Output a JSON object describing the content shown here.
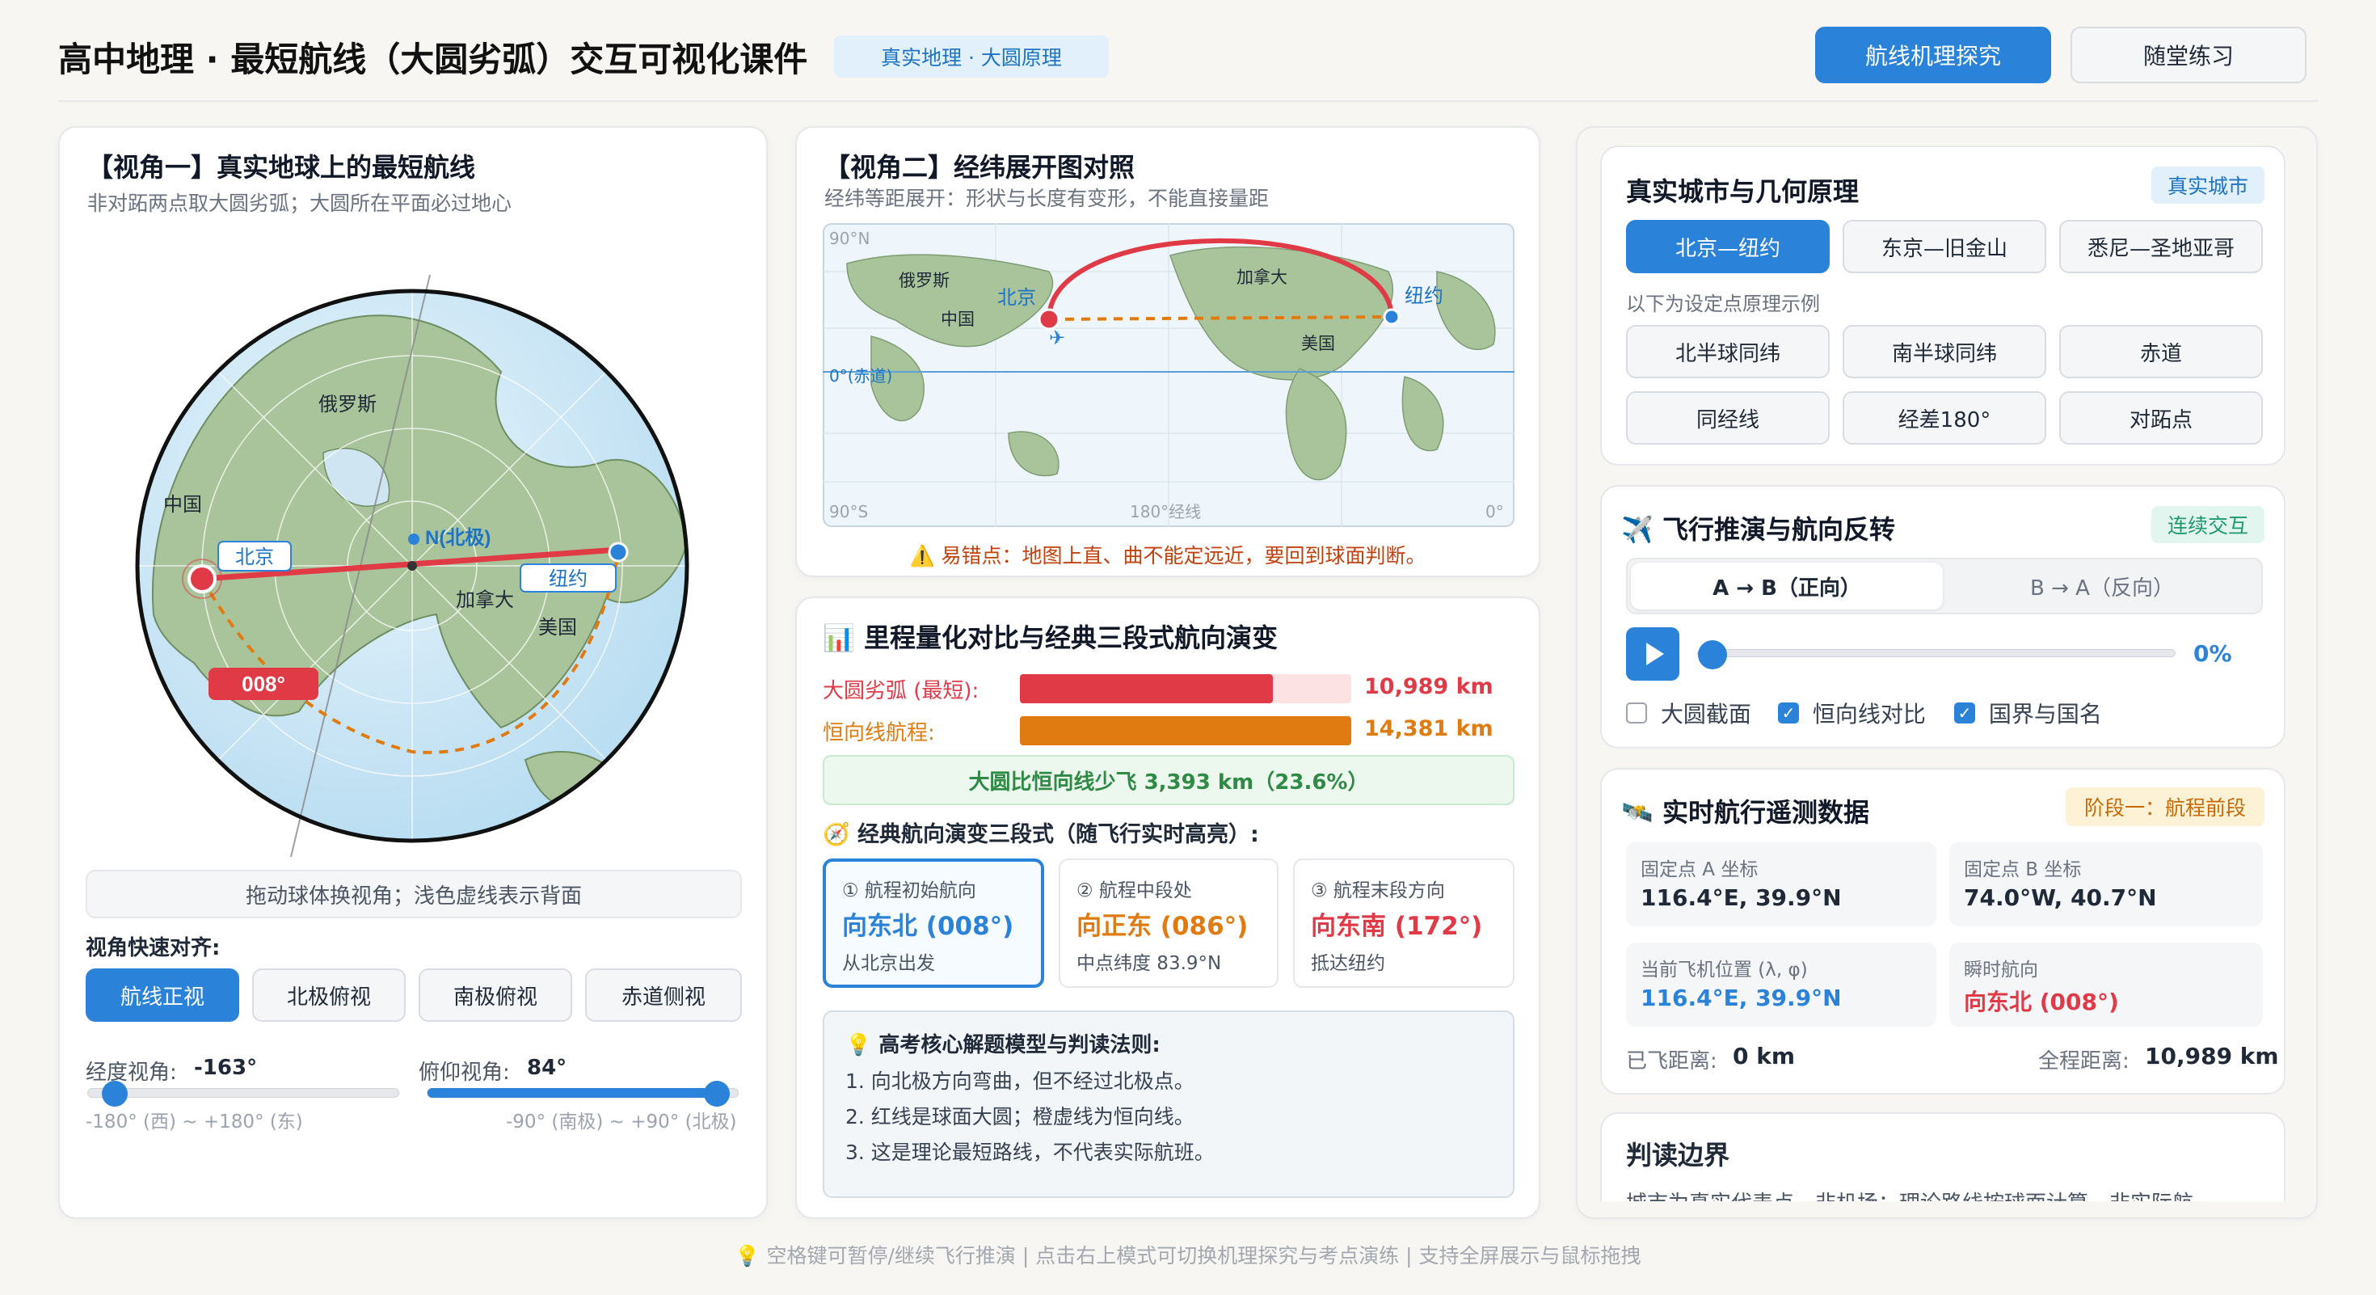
{
  "header": {
    "title": "高中地理 · 最短航线（大圆劣弧）交互可视化课件",
    "tag": "真实地理 · 大圆原理",
    "mode_explore": "航线机理探究",
    "mode_practice": "随堂练习"
  },
  "panel1": {
    "title": "【视角一】真实地球上的最短航线",
    "subtitle": "非对跖两点取大圆劣弧；大圆所在平面必过地心",
    "globe_labels": {
      "russia": "俄罗斯",
      "china": "中国",
      "north_pole": "N(北极)",
      "beijing": "北京",
      "newyork": "纽约",
      "canada": "加拿大",
      "usa": "美国",
      "heading_badge": "008°"
    },
    "drag_hint": "拖动球体换视角；浅色虚线表示背面",
    "quick_align_label": "视角快速对齐:",
    "views": [
      "航线正视",
      "北极俯视",
      "南极俯视",
      "赤道侧视"
    ],
    "lon_label": "经度视角:",
    "lon_value": "-163°",
    "lon_range": "-180° (西) ~ +180° (东)",
    "lon_fraction": 0.047,
    "tilt_label": "俯仰视角:",
    "tilt_value": "84°",
    "tilt_range": "-90° (南极) ~ +90° (北极)",
    "tilt_fraction": 0.967
  },
  "panel2": {
    "title": "【视角二】经纬展开图对照",
    "subtitle": "经纬等距展开：形状与长度有变形，不能直接量距",
    "map_labels": {
      "lat90n": "90°N",
      "equator": "0°(赤道)",
      "lat90s": "90°S",
      "lon180": "180°经线",
      "lon0": "0°",
      "russia": "俄罗斯",
      "china": "中国",
      "beijing": "北京",
      "canada": "加拿大",
      "newyork": "纽约",
      "usa": "美国"
    },
    "warning": "⚠️ 易错点：地图上直、曲不能定远近，要回到球面判断。"
  },
  "panel3": {
    "title": "📊 里程量化对比与经典三段式航向演变",
    "gc_label": "大圆劣弧 (最短):",
    "gc_value": "10,989 km",
    "gc_fraction": 0.763,
    "rh_label": "恒向线航程:",
    "rh_value": "14,381 km",
    "rh_fraction": 1.0,
    "saving": "大圆比恒向线少飞 3,393 km（23.6%）",
    "stages_title": "🧭 经典航向演变三段式（随飞行实时高亮）:",
    "stages": [
      {
        "label": "① 航程初始航向",
        "value": "向东北 (008°)",
        "note": "从北京出发"
      },
      {
        "label": "② 航程中段处",
        "value": "向正东 (086°)",
        "note": "中点纬度 83.9°N"
      },
      {
        "label": "③ 航程末段方向",
        "value": "向东南 (172°)",
        "note": "抵达纽约"
      }
    ],
    "rules_title": "💡 高考核心解题模型与判读法则:",
    "rules": [
      "1. 向北极方向弯曲，但不经过北极点。",
      "2. 红线是球面大圆；橙虚线为恒向线。",
      "3. 这是理论最短路线，不代表实际航班。"
    ]
  },
  "panel4": {
    "title": "真实城市与几何原理",
    "tag": "真实城市",
    "cities": [
      "北京—纽约",
      "东京—旧金山",
      "悉尼—圣地亚哥"
    ],
    "hint": "以下为设定点原理示例",
    "principles": [
      "北半球同纬",
      "南半球同纬",
      "赤道",
      "同经线",
      "经差180°",
      "对跖点"
    ]
  },
  "panel5": {
    "title": "✈️ 飞行推演与航向反转",
    "tag": "连续交互",
    "dir_forward": "A → B（正向）",
    "dir_reverse": "B → A（反向）",
    "progress": "0%",
    "progress_fraction": 0,
    "opt_section": "大圆截面",
    "opt_rhumb": "恒向线对比",
    "opt_border": "国界与国名",
    "checked": {
      "section": false,
      "rhumb": true,
      "border": true
    }
  },
  "panel6": {
    "title": "🛰️ 实时航行遥测数据",
    "phase": "阶段一：航程前段",
    "a_label": "固定点 A 坐标",
    "a_value": "116.4°E, 39.9°N",
    "b_label": "固定点 B 坐标",
    "b_value": "74.0°W, 40.7°N",
    "pos_label": "当前飞机位置 (λ, φ)",
    "pos_value": "116.4°E, 39.9°N",
    "hdg_label": "瞬时航向",
    "hdg_value": "向东北 (008°)",
    "flown_label": "已飞距离:",
    "flown_value": "0 km",
    "total_label": "全程距离:",
    "total_value": "10,989 km"
  },
  "panel7": {
    "title": "判读边界",
    "text": "城市为真实代表点，非机场；理论路线按球面计算，非实际航"
  },
  "footer": "💡 空格键可暂停/继续飞行推演 | 点击右上模式可切换机理探究与考点演练 | 支持全屏展示与鼠标拖拽",
  "colors": {
    "accent": "#2a82d9",
    "great_circle": "#e03a47",
    "rhumb": "#e07b12",
    "land": "#a9c49a"
  }
}
